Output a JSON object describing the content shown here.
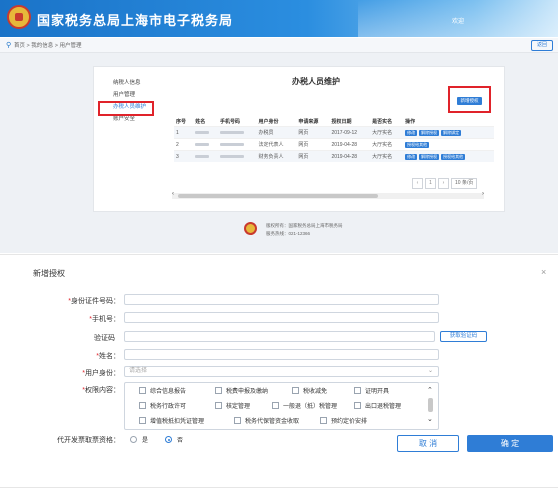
{
  "header": {
    "title": "国家税务总局上海市电子税务局",
    "welcome": "欢迎"
  },
  "breadcrumb": {
    "text": "首页 > 我的信息 > 用户管理",
    "back_label": "返回"
  },
  "side_menu": [
    "纳税人信息",
    "用户管理",
    "办税人员维护",
    "账户安全"
  ],
  "panel": {
    "title": "办税人员维护",
    "add_button": "新增授权",
    "columns": [
      "序号",
      "姓名",
      "手机号码",
      "用户身份",
      "申请来源",
      "授权日期",
      "是否实名",
      "操作"
    ],
    "rows": [
      {
        "no": "1",
        "identity": "办税员",
        "source": "网页",
        "date": "2017-09-12",
        "realname": "大厅实名",
        "actions": [
          "修改",
          "解除授权",
          "解除绑定"
        ]
      },
      {
        "no": "2",
        "identity": "法定代表人",
        "source": "网页",
        "date": "2019-04-28",
        "realname": "大厅实名",
        "actions": [
          "授权给其他"
        ]
      },
      {
        "no": "3",
        "identity": "财务负责人",
        "source": "网页",
        "date": "2019-04-28",
        "realname": "大厅实名",
        "actions": [
          "修改",
          "解除授权",
          "授权给其他"
        ]
      }
    ],
    "pager": {
      "page": "1",
      "page_size": "10 条/页"
    }
  },
  "footer": {
    "line1": "版权所有：国家税务总局上海市税务局",
    "line2": "服务热线：021-12366"
  },
  "dialog": {
    "title": "新增授权",
    "close": "×",
    "fields": {
      "id_label": "身份证件号码：",
      "phone_label": "手机号：",
      "code_label": "验证码",
      "get_code": "获取验证码",
      "name_label": "姓名：",
      "identity_label": "用户身份：",
      "identity_placeholder": "请选择",
      "perm_label": "权限内容：",
      "invoice_label": "代开发票取票资格："
    },
    "permissions": [
      "综合信息报告",
      "税费申报及缴纳",
      "税收减免",
      "证明开具",
      "税务行政许可",
      "核定管理",
      "一般退（抵）税管理",
      "出口退税管理",
      "增值税抵扣凭证管理",
      "税务代保管资金收取",
      "预约定价安排"
    ],
    "invoice_options": [
      "是",
      "否"
    ],
    "cancel": "取 消",
    "ok": "确 定"
  },
  "colors": {
    "primary": "#2f7dd6",
    "required": "#e0232a",
    "highlight_box": "#e0232a"
  }
}
